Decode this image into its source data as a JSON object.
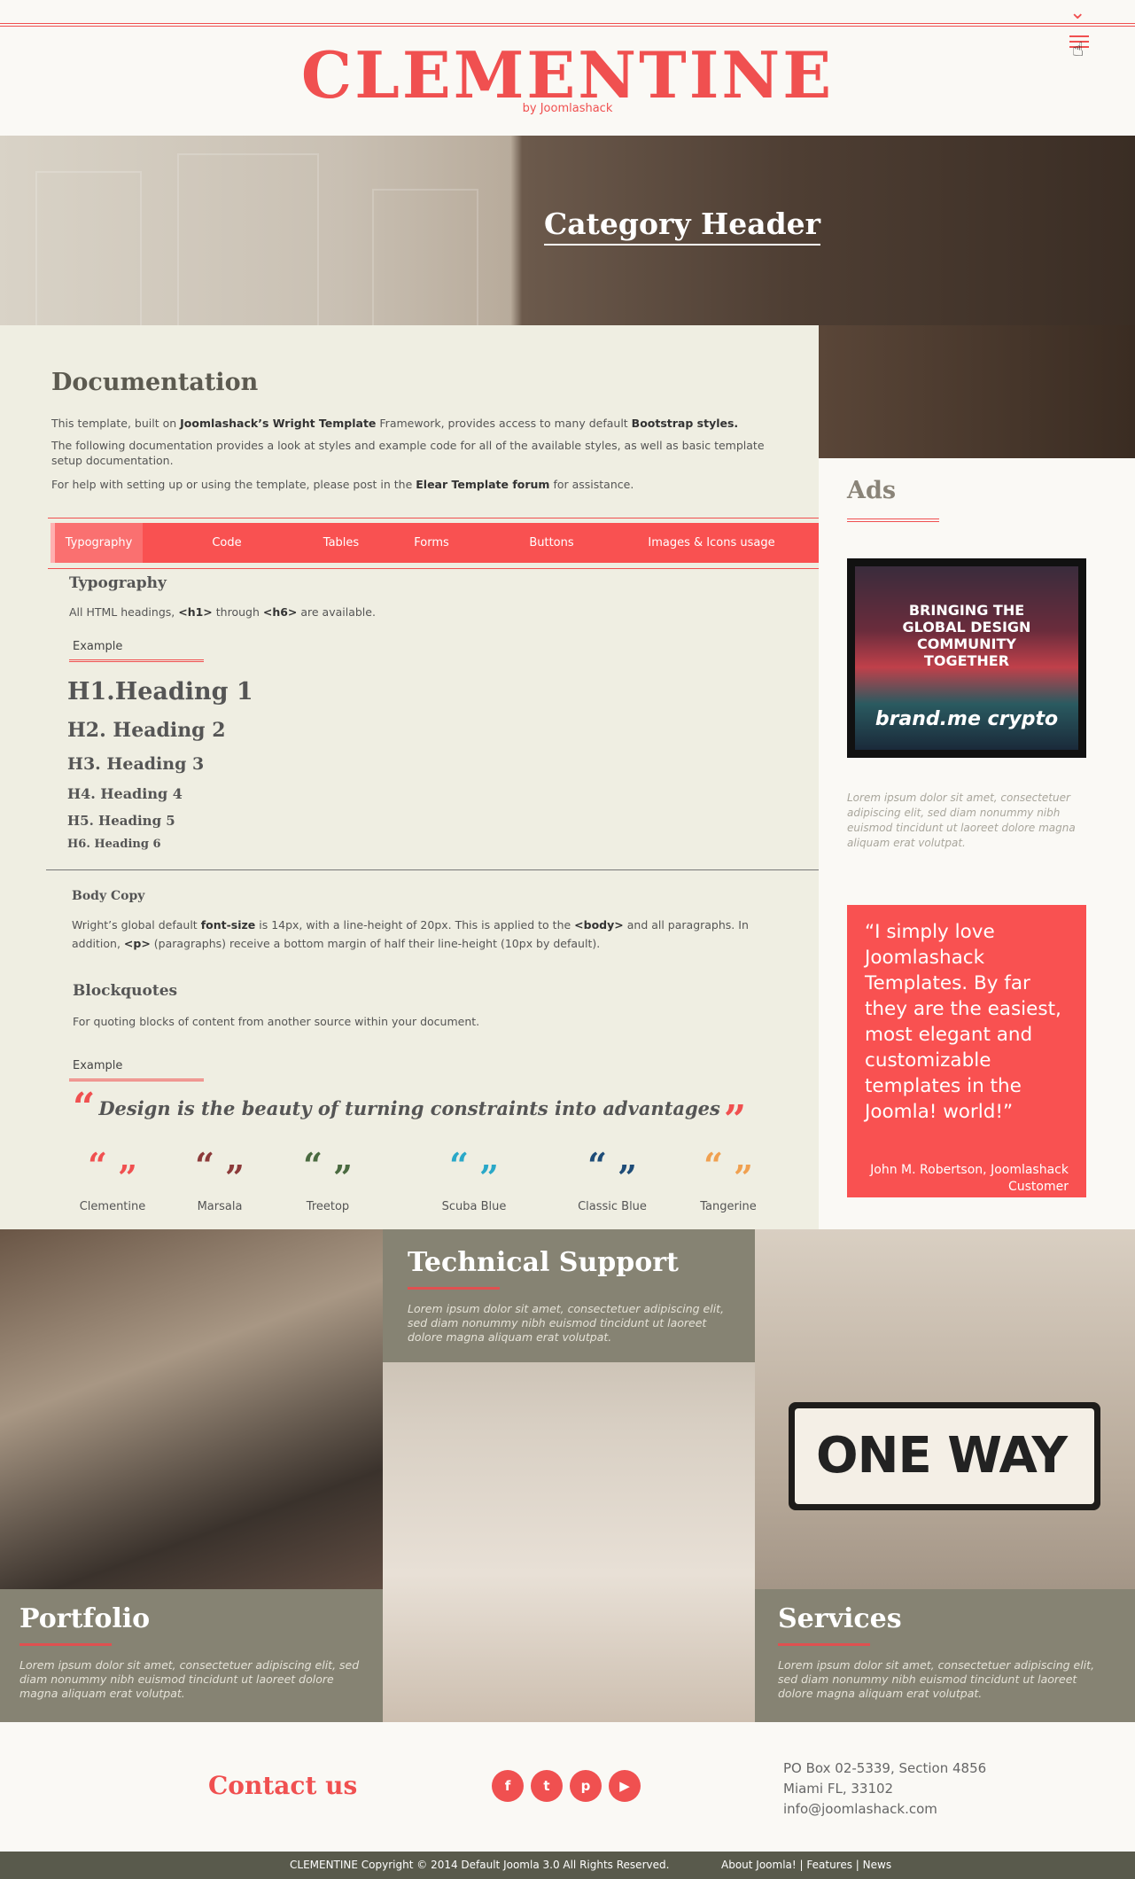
{
  "header": {
    "logo": "CLEMENTINE",
    "logo_sub": "by Joomlashack",
    "toggle_icon": "chevron-down-icon",
    "menu_icon": "hamburger-icon"
  },
  "hero": {
    "title": "Category Header"
  },
  "main": {
    "title": "Documentation",
    "intro": {
      "p1_a": "This template, built on ",
      "p1_b": "Joomlashack’s Wright Template",
      "p1_c": " Framework, provides access to many default ",
      "p1_d": "Bootstrap styles.",
      "p2": "The following documentation provides a look at styles and example code for all of the available styles, as well as basic template setup documentation.",
      "p3_a": "For help with setting up or using the template, please post in the ",
      "p3_b": "Elear Template forum",
      "p3_c": " for assistance."
    },
    "tabs": [
      "Typography",
      "Code",
      "Tables",
      "Forms",
      "Buttons",
      "Images & Icons usage"
    ],
    "typography": {
      "title": "Typography",
      "desc_a": "All HTML headings, ",
      "desc_b": "<h1>",
      "desc_c": " through ",
      "desc_d": "<h6>",
      "desc_e": " are available.",
      "example_label": "Example",
      "headings": [
        "H1.Heading 1",
        "H2. Heading 2",
        "H3. Heading 3",
        "H4. Heading 4",
        "H5. Heading 5",
        "H6. Heading 6"
      ]
    },
    "body_copy": {
      "title": "Body Copy",
      "text_a": "Wright’s global default ",
      "text_b": "font-size",
      "text_c": " is 14px, with a line-height of 20px. This is applied to the ",
      "text_d": "<body>",
      "text_e": " and all paragraphs. In addition, ",
      "text_f": "<p>",
      "text_g": " (paragraphs) receive a bottom margin of half their line-height (10px by default)."
    },
    "blockquotes": {
      "title": "Blockquotes",
      "desc": "For quoting blocks of content from another source within your document.",
      "example_label": "Example",
      "quote": "Design is the beauty of turning constraints into advantages",
      "open_mark": "“",
      "close_mark": "”"
    },
    "swatches": [
      {
        "name": "Clementine",
        "c1": "#f05050",
        "c2": "#f05050"
      },
      {
        "name": "Marsala",
        "c1": "#8c3a3a",
        "c2": "#8c3a3a"
      },
      {
        "name": "Treetop",
        "c1": "#4a6a40",
        "c2": "#4a6a40"
      },
      {
        "name": "Scuba Blue",
        "c1": "#2aa8c8",
        "c2": "#2aa8c8"
      },
      {
        "name": "Classic Blue",
        "c1": "#1e4c78",
        "c2": "#1e4c78"
      },
      {
        "name": "Tangerine",
        "c1": "#f0a050",
        "c2": "#f0a050"
      }
    ]
  },
  "sidebar": {
    "ads_title": "Ads",
    "ad_text": "BRINGING THE GLOBAL DESIGN COMMUNITY TOGETHER",
    "ad_logo": "brand.me crypto",
    "lorem": "Lorem ipsum dolor sit amet, consectetuer adipiscing elit, sed diam nonummy nibh euismod tincidunt ut laoreet dolore magna aliquam erat volutpat.",
    "quote": "“I simply love Joomlashack Templates. By far they are the easiest, most elegant and customizable templates in the Joomla! world!”",
    "quote_by": "John M. Robertson, Joomlashack Customer"
  },
  "tiles": [
    {
      "title": "Portfolio",
      "text": "Lorem ipsum dolor sit amet, consectetuer adipiscing elit, sed diam nonummy nibh euismod tincidunt ut laoreet dolore magna aliquam erat volutpat."
    },
    {
      "title": "Technical Support",
      "text": "Lorem ipsum dolor sit amet, consectetuer adipiscing elit, sed diam nonummy nibh euismod tincidunt ut laoreet dolore magna aliquam erat volutpat."
    },
    {
      "title": "Services",
      "text": "Lorem ipsum dolor sit amet, consectetuer adipiscing elit, sed diam nonummy nibh euismod tincidunt ut laoreet dolore magna aliquam erat volutpat."
    }
  ],
  "sign_text": "ONE WAY",
  "contact": {
    "title": "Contact us",
    "social": [
      {
        "icon": "facebook-icon",
        "glyph": "f"
      },
      {
        "icon": "twitter-icon",
        "glyph": "t"
      },
      {
        "icon": "pinterest-icon",
        "glyph": "p"
      },
      {
        "icon": "youtube-icon",
        "glyph": "▶"
      }
    ],
    "address": [
      "PO Box 02-5339, Section 4856",
      "Miami FL, 33102",
      "info@joomlashack.com"
    ]
  },
  "footer": {
    "copyright": "CLEMENTINE Copyright © 2014 Default Joomla 3.0 All Rights Reserved.",
    "links": [
      "About Joomla!",
      "Features",
      "News"
    ]
  }
}
